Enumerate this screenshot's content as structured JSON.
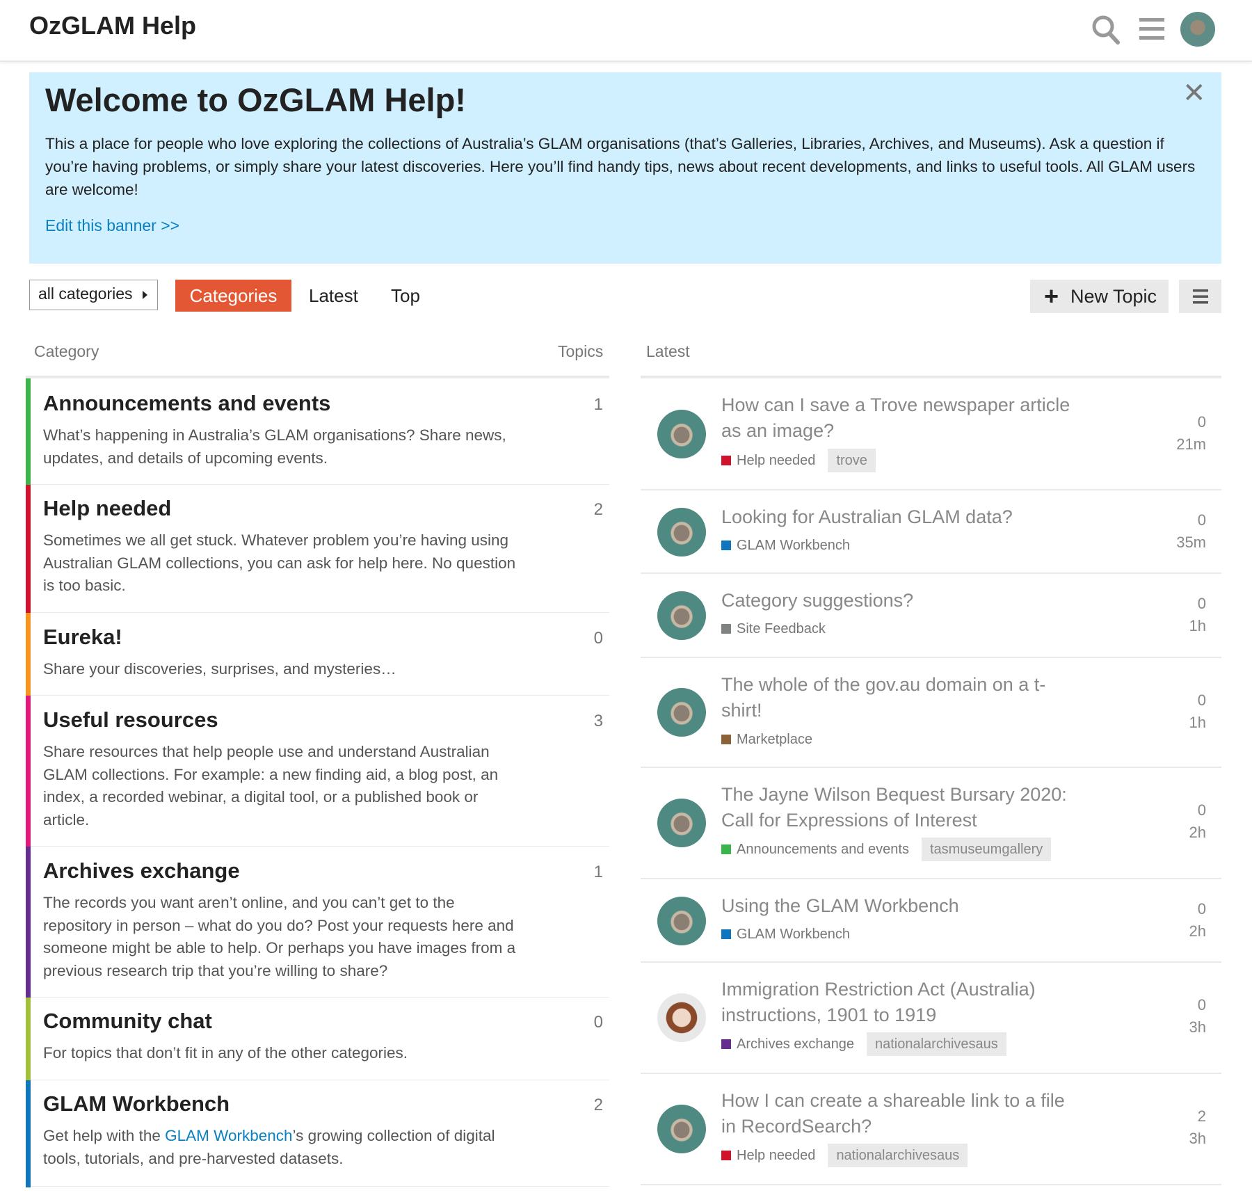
{
  "header": {
    "title": "OzGLAM Help"
  },
  "banner": {
    "title": "Welcome to OzGLAM Help!",
    "text": "This a place for people who love exploring the collections of Australia’s GLAM organisations (that’s Galleries, Libraries, Archives, and Museums). Ask a question if you’re having problems, or simply share your latest discoveries. Here you’ll find handy tips, news about recent developments, and links to useful tools. All GLAM users are welcome!",
    "edit_link": "Edit this banner >>",
    "close": "✕"
  },
  "nav": {
    "category_dropdown": "all categories",
    "tabs": [
      "Categories",
      "Latest",
      "Top"
    ],
    "new_topic": "New Topic",
    "new_topic_plus": "+"
  },
  "columns": {
    "category": "Category",
    "topics": "Topics",
    "latest": "Latest"
  },
  "categories": [
    {
      "name": "Announcements and events",
      "desc": "What’s happening in Australia’s GLAM organisations? Share news, updates, and details of upcoming events.",
      "count": "1",
      "color": "#3ab54a"
    },
    {
      "name": "Help needed",
      "desc": "Sometimes we all get stuck. Whatever problem you’re having using Australian GLAM collections, you can ask for help here. No question is too basic.",
      "count": "2",
      "color": "#d0122d"
    },
    {
      "name": "Eureka!",
      "desc": "Share your discoveries, surprises, and mysteries…",
      "count": "0",
      "color": "#f7941d"
    },
    {
      "name": "Useful resources",
      "desc": "Share resources that help people use and understand Australian GLAM collections. For example: a new finding aid, a blog post, an index, a recorded webinar, a digital tool, or a published book or article.",
      "count": "3",
      "color": "#e4187b"
    },
    {
      "name": "Archives exchange",
      "desc": "The records you want aren’t online, and you can’t get to the repository in person – what do you do? Post your requests here and someone might be able to help. Or perhaps you have images from a previous research trip that you’re willing to share?",
      "count": "1",
      "color": "#652d90"
    },
    {
      "name": "Community chat",
      "desc": "For topics that don’t fit in any of the other categories.",
      "count": "0",
      "color": "#a3c03b"
    },
    {
      "name": "GLAM Workbench",
      "desc_pre": "Get help with the ",
      "desc_link": "GLAM Workbench",
      "desc_post": "’s growing collection of digital tools, tutorials, and pre-harvested datasets.",
      "count": "2",
      "color": "#0e76bd"
    }
  ],
  "topics": [
    {
      "title": "How can I save a Trove newspaper article as an image?",
      "category": "Help needed",
      "category_color": "#d0122d",
      "tag": "trove",
      "replies": "0",
      "age": "21m",
      "avatar": "man-avatar"
    },
    {
      "title": "Looking for Australian GLAM data?",
      "category": "GLAM Workbench",
      "category_color": "#0e76bd",
      "tag": "",
      "replies": "0",
      "age": "35m",
      "avatar": "man-avatar"
    },
    {
      "title": "Category suggestions?",
      "category": "Site Feedback",
      "category_color": "#808281",
      "tag": "",
      "replies": "0",
      "age": "1h",
      "avatar": "man-avatar"
    },
    {
      "title": "The whole of the gov.au domain on a t-shirt!",
      "category": "Marketplace",
      "category_color": "#8c6238",
      "tag": "",
      "replies": "0",
      "age": "1h",
      "avatar": "man-avatar"
    },
    {
      "title": "The Jayne Wilson Bequest Bursary 2020: Call for Expressions of Interest",
      "category": "Announcements and events",
      "category_color": "#3ab54a",
      "tag": "tasmuseumgallery",
      "replies": "0",
      "age": "2h",
      "avatar": "man-avatar"
    },
    {
      "title": "Using the GLAM Workbench",
      "category": "GLAM Workbench",
      "category_color": "#0e76bd",
      "tag": "",
      "replies": "0",
      "age": "2h",
      "avatar": "man-avatar"
    },
    {
      "title": "Immigration Restriction Act (Australia) instructions, 1901 to 1919",
      "category": "Archives exchange",
      "category_color": "#652d90",
      "tag": "nationalarchivesaus",
      "replies": "0",
      "age": "3h",
      "avatar": "woman-avatar"
    },
    {
      "title": "How I can create a shareable link to a file in RecordSearch?",
      "category": "Help needed",
      "category_color": "#d0122d",
      "tag": "nationalarchivesaus",
      "replies": "2",
      "age": "3h",
      "avatar": "man-avatar"
    }
  ]
}
